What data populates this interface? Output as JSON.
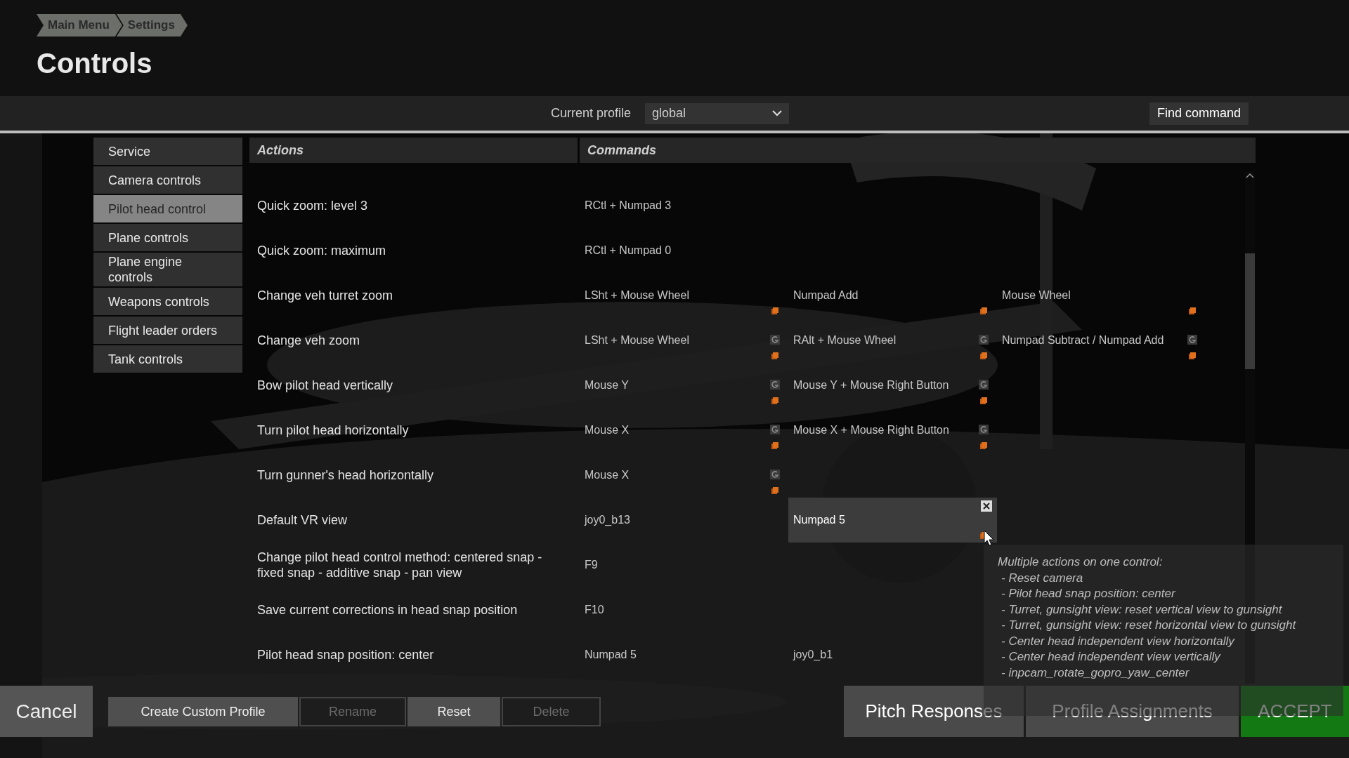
{
  "breadcrumb": [
    {
      "label": "Main Menu"
    },
    {
      "label": "Settings"
    }
  ],
  "title": "Controls",
  "profile": {
    "label": "Current profile",
    "value": "global"
  },
  "find_button": "Find command",
  "categories": [
    {
      "label": "Service",
      "selected": false
    },
    {
      "label": "Camera controls",
      "selected": false
    },
    {
      "label": "Pilot head control",
      "selected": true
    },
    {
      "label": "Plane controls",
      "selected": false
    },
    {
      "label": "Plane engine controls",
      "selected": false
    },
    {
      "label": "Weapons controls",
      "selected": false
    },
    {
      "label": "Flight leader orders",
      "selected": false
    },
    {
      "label": "Tank controls",
      "selected": false
    }
  ],
  "table": {
    "columns": [
      "Actions",
      "Commands"
    ],
    "rows": [
      {
        "action": "Quick zoom: level 3",
        "commands": [
          {
            "text": "RCtl + Numpad 3",
            "modified": false,
            "conflict": false,
            "selected": false
          }
        ]
      },
      {
        "action": "Quick zoom: maximum",
        "commands": [
          {
            "text": "RCtl + Numpad 0",
            "modified": false,
            "conflict": false,
            "selected": false
          }
        ]
      },
      {
        "action": "Change veh turret zoom",
        "commands": [
          {
            "text": "LSht + Mouse Wheel",
            "modified": false,
            "conflict": true,
            "selected": false
          },
          {
            "text": "Numpad Add",
            "modified": false,
            "conflict": true,
            "selected": false
          },
          {
            "text": "Mouse Wheel",
            "modified": false,
            "conflict": true,
            "selected": false
          }
        ]
      },
      {
        "action": "Change veh zoom",
        "commands": [
          {
            "text": "LSht + Mouse Wheel",
            "modified": true,
            "conflict": true,
            "selected": false
          },
          {
            "text": "RAlt + Mouse Wheel",
            "modified": true,
            "conflict": true,
            "selected": false
          },
          {
            "text": "Numpad Subtract / Numpad Add",
            "modified": true,
            "conflict": true,
            "selected": false
          }
        ]
      },
      {
        "action": "Bow pilot head vertically",
        "commands": [
          {
            "text": "Mouse Y",
            "modified": true,
            "conflict": true,
            "selected": false
          },
          {
            "text": "Mouse Y + Mouse Right Button",
            "modified": true,
            "conflict": true,
            "selected": false
          }
        ]
      },
      {
        "action": "Turn pilot head horizontally",
        "commands": [
          {
            "text": "Mouse X",
            "modified": true,
            "conflict": true,
            "selected": false
          },
          {
            "text": "Mouse X + Mouse Right Button",
            "modified": true,
            "conflict": true,
            "selected": false
          }
        ]
      },
      {
        "action": "Turn gunner's head horizontally",
        "commands": [
          {
            "text": "Mouse X",
            "modified": true,
            "conflict": true,
            "selected": false
          }
        ]
      },
      {
        "action": "Default VR view",
        "commands": [
          {
            "text": "joy0_b13",
            "modified": false,
            "conflict": false,
            "selected": false
          },
          {
            "text": "Numpad 5",
            "modified": false,
            "conflict": true,
            "selected": true
          }
        ]
      },
      {
        "action": "Change pilot head control method: centered snap - fixed snap - additive snap - pan view",
        "commands": [
          {
            "text": "F9",
            "modified": false,
            "conflict": false,
            "selected": false
          }
        ]
      },
      {
        "action": "Save current corrections in head snap position",
        "commands": [
          {
            "text": "F10",
            "modified": false,
            "conflict": false,
            "selected": false
          }
        ]
      },
      {
        "action": "Pilot head snap position: center",
        "commands": [
          {
            "text": "Numpad 5",
            "modified": false,
            "conflict": false,
            "selected": false
          },
          {
            "text": "joy0_b1",
            "modified": false,
            "conflict": false,
            "selected": false
          }
        ]
      }
    ]
  },
  "tooltip": {
    "title": "Multiple actions on one control:",
    "items": [
      "- Reset camera",
      "- Pilot head snap position: center",
      "- Turret, gunsight view: reset vertical view to gunsight",
      "- Turret, gunsight view: reset horizontal view to gunsight",
      "- Center head independent view horizontally",
      "- Center head independent view vertically",
      "- inpcam_rotate_gopro_yaw_center"
    ]
  },
  "cancel_button": "Cancel",
  "profile_buttons": [
    {
      "label": "Create Custom Profile",
      "disabled": false
    },
    {
      "label": "Rename",
      "disabled": true
    },
    {
      "label": "Reset",
      "disabled": false
    },
    {
      "label": "Delete",
      "disabled": true
    }
  ],
  "right_buttons": [
    {
      "label": "Pitch Responses",
      "kind": "secondary"
    },
    {
      "label": "Profile Assignments",
      "kind": "secondary"
    },
    {
      "label": "ACCEPT",
      "kind": "primary"
    }
  ]
}
